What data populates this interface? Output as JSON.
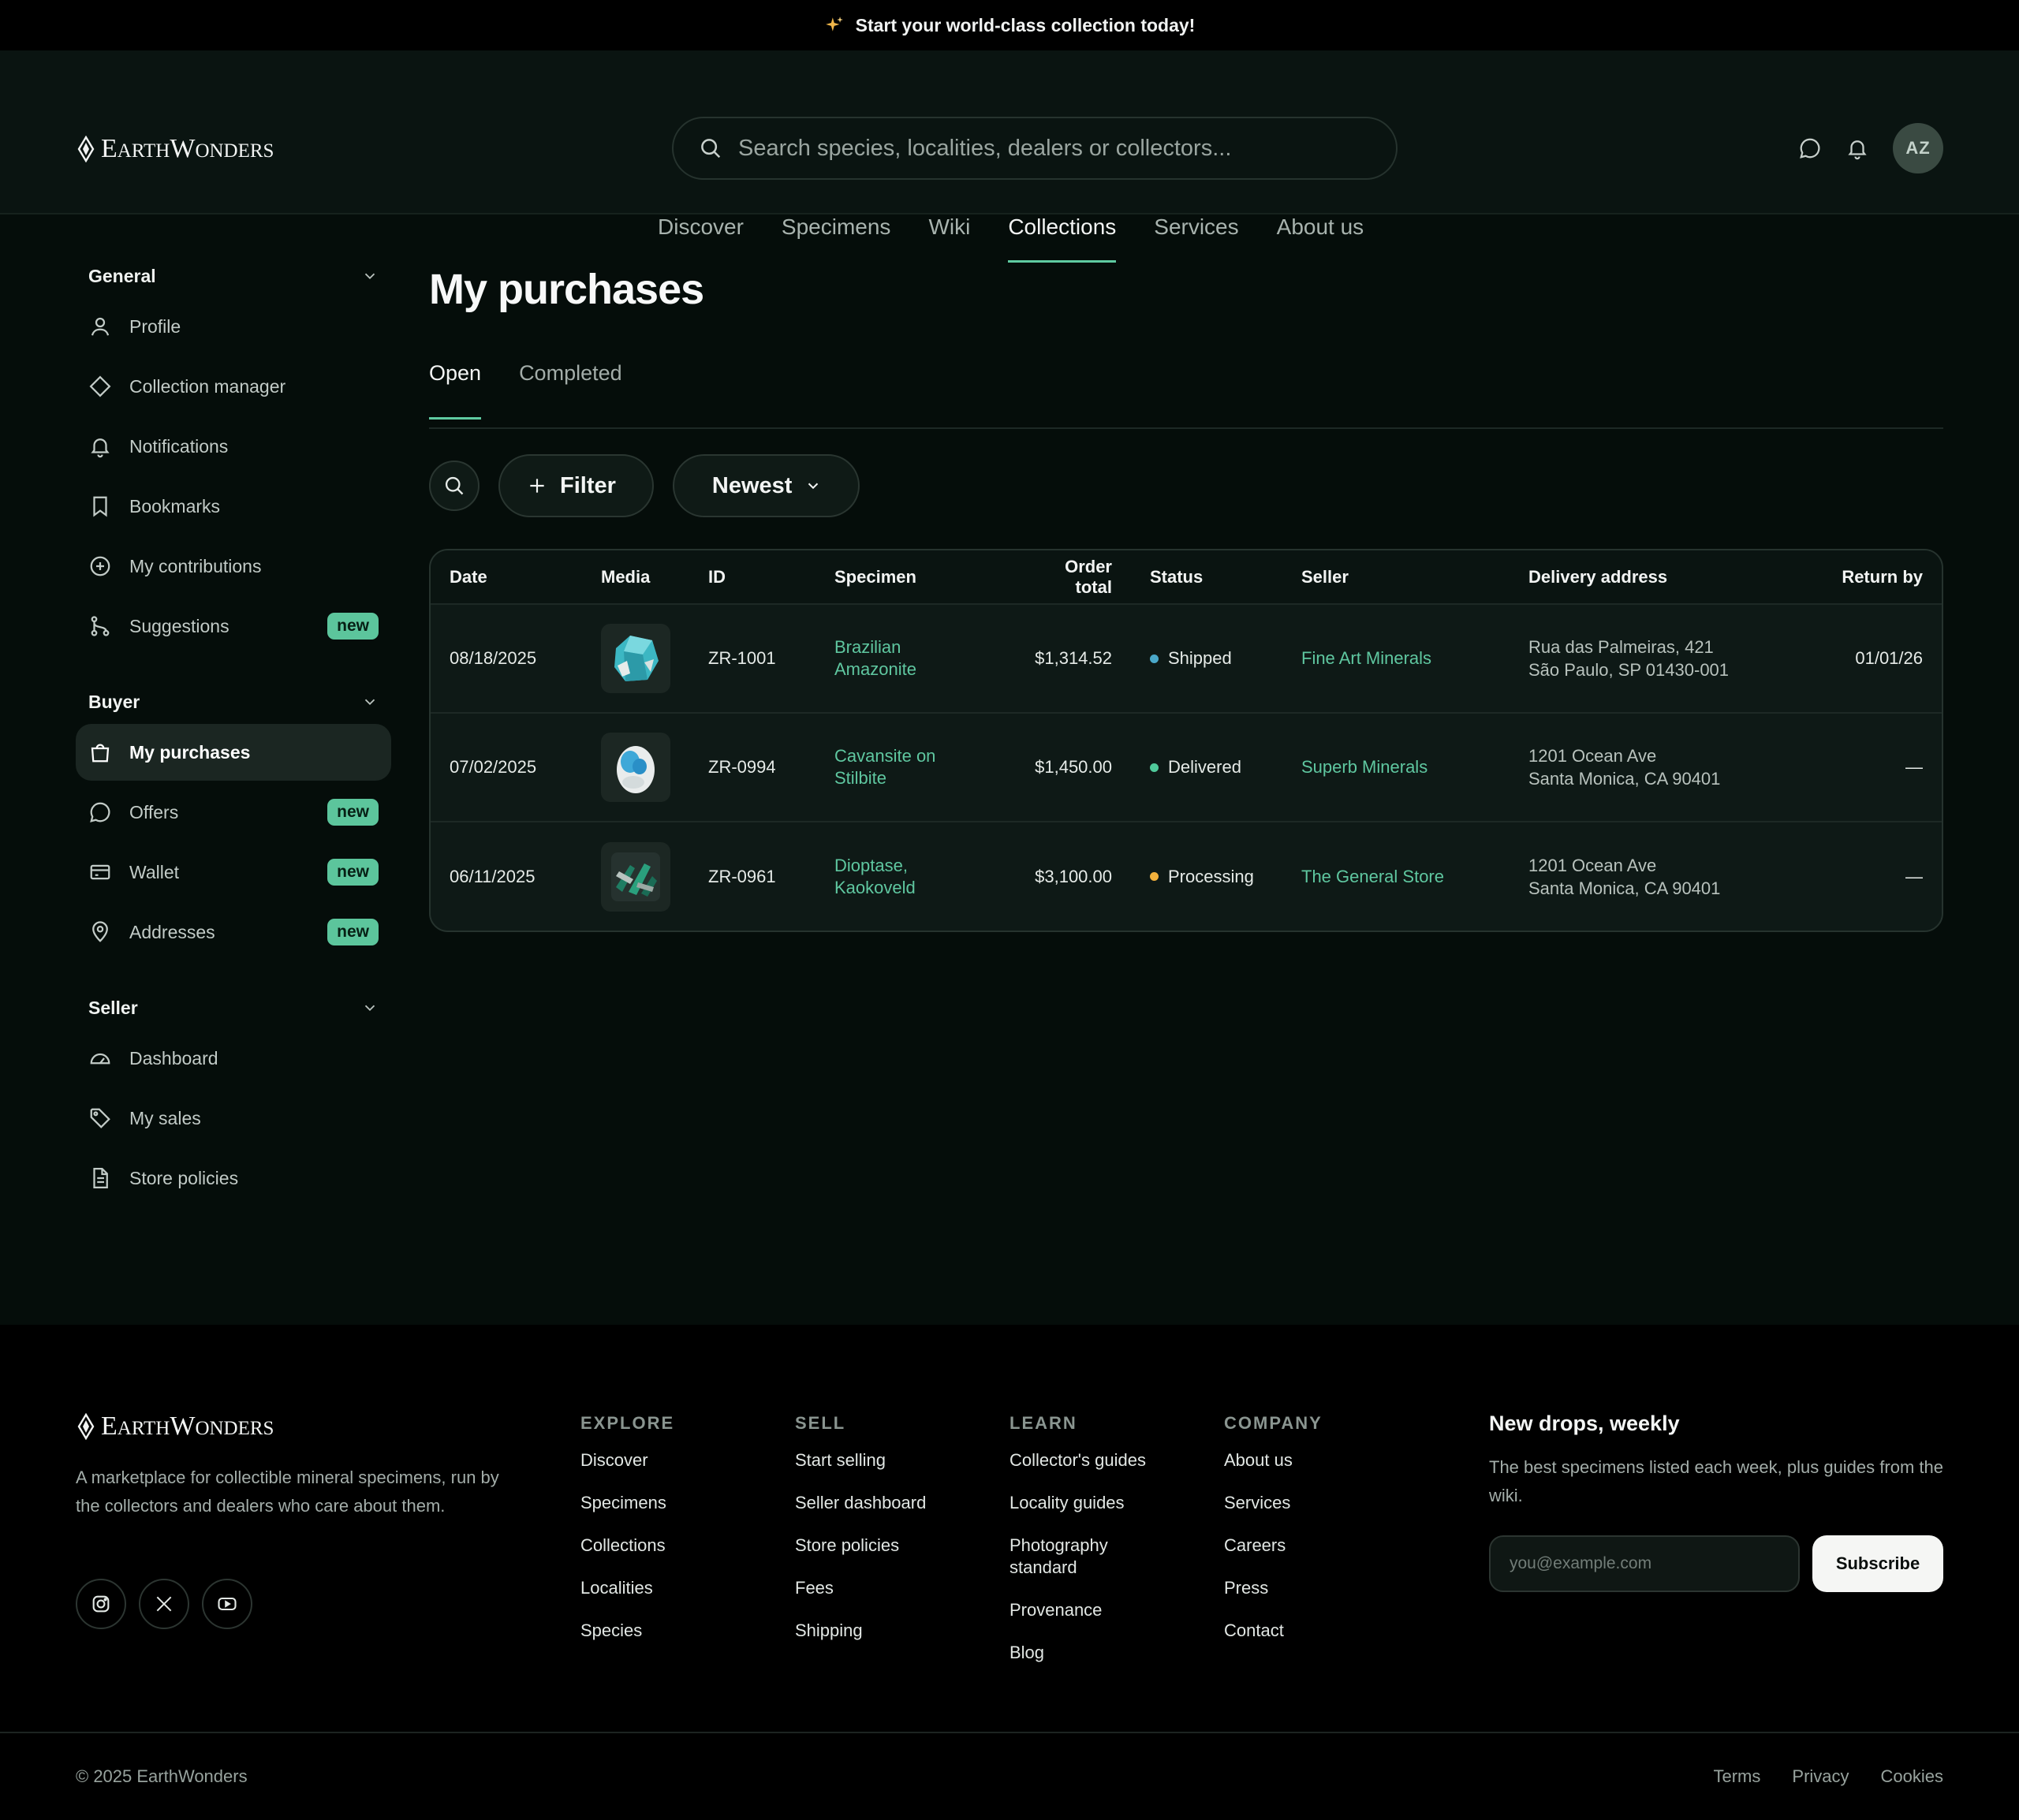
{
  "announcement": {
    "text": "Start your world-class collection today!"
  },
  "brand": {
    "name_first": "E",
    "name_rest": "ARTH",
    "name_second": "W",
    "name_rest2": "ONDERS"
  },
  "search": {
    "placeholder": "Search species, localities, dealers or collectors..."
  },
  "user": {
    "initials": "AZ"
  },
  "nav": {
    "items": [
      {
        "label": "Discover"
      },
      {
        "label": "Specimens"
      },
      {
        "label": "Wiki"
      },
      {
        "label": "Collections",
        "active": true
      },
      {
        "label": "Services"
      },
      {
        "label": "About us"
      }
    ]
  },
  "sidebar": {
    "general": {
      "title": "General",
      "items": [
        {
          "label": "Profile",
          "icon": "user-icon"
        },
        {
          "label": "Collection manager",
          "icon": "diamond-icon"
        },
        {
          "label": "Notifications",
          "icon": "bell-icon"
        },
        {
          "label": "Bookmarks",
          "icon": "bookmark-icon"
        },
        {
          "label": "My contributions",
          "icon": "plus-circle-icon"
        },
        {
          "label": "Suggestions",
          "icon": "git-branch-icon",
          "badge": "new"
        }
      ]
    },
    "buyer": {
      "title": "Buyer",
      "items": [
        {
          "label": "My purchases",
          "icon": "shopping-bag-icon",
          "active": true
        },
        {
          "label": "Offers",
          "icon": "chat-icon",
          "badge": "new"
        },
        {
          "label": "Wallet",
          "icon": "wallet-icon",
          "badge": "new"
        },
        {
          "label": "Addresses",
          "icon": "map-pin-icon",
          "badge": "new"
        }
      ]
    },
    "seller": {
      "title": "Seller",
      "items": [
        {
          "label": "Dashboard",
          "icon": "gauge-icon"
        },
        {
          "label": "My sales",
          "icon": "tag-icon"
        },
        {
          "label": "Store policies",
          "icon": "document-icon"
        }
      ]
    }
  },
  "main": {
    "title": "My purchases",
    "tabs": [
      {
        "label": "Open",
        "active": true
      },
      {
        "label": "Completed"
      }
    ],
    "filter_label": "Filter",
    "sort_label": "Newest"
  },
  "table": {
    "columns": [
      "Date",
      "Media",
      "ID",
      "Specimen",
      "Order total",
      "Status",
      "Seller",
      "Delivery address",
      "Return by"
    ],
    "rows": [
      {
        "date": "08/18/2025",
        "id": "ZR-1001",
        "specimen_line1": "Brazilian",
        "specimen_line2": "Amazonite",
        "total": "$1,314.52",
        "status": "Shipped",
        "status_color": "#4aa8c9",
        "seller": "Fine Art Minerals",
        "addr1": "Rua das Palmeiras, 421",
        "addr2": "São Paulo, SP 01430-001",
        "return_by": "01/01/26"
      },
      {
        "date": "07/02/2025",
        "id": "ZR-0994",
        "specimen_line1": "Cavansite on",
        "specimen_line2": "Stilbite",
        "total": "$1,450.00",
        "status": "Delivered",
        "status_color": "#4fc99a",
        "seller": "Superb Minerals",
        "addr1": "1201 Ocean Ave",
        "addr2": "Santa Monica, CA 90401",
        "return_by": "—"
      },
      {
        "date": "06/11/2025",
        "id": "ZR-0961",
        "specimen_line1": "Dioptase,",
        "specimen_line2": "Kaokoveld",
        "total": "$3,100.00",
        "status": "Processing",
        "status_color": "#f2b13c",
        "seller": "The General Store",
        "addr1": "1201 Ocean Ave",
        "addr2": "Santa Monica, CA 90401",
        "return_by": "—"
      }
    ]
  },
  "footer": {
    "description": "A marketplace for collectible mineral specimens, run by the collectors and dealers who care about them.",
    "columns": [
      {
        "title": "EXPLORE",
        "links": [
          "Discover",
          "Specimens",
          "Collections",
          "Localities",
          "Species"
        ]
      },
      {
        "title": "SELL",
        "links": [
          "Start selling",
          "Seller dashboard",
          "Store policies",
          "Fees",
          "Shipping"
        ]
      },
      {
        "title": "LEARN",
        "links": [
          "Collector's guides",
          "Locality guides",
          "Photography standard",
          "Provenance",
          "Blog"
        ]
      },
      {
        "title": "COMPANY",
        "links": [
          "About us",
          "Services",
          "Careers",
          "Press",
          "Contact"
        ]
      }
    ],
    "newsletter": {
      "title": "New drops, weekly",
      "text": "The best specimens listed each week, plus guides from the wiki.",
      "placeholder": "you@example.com",
      "button": "Subscribe"
    },
    "copyright": "© 2025 EarthWonders",
    "legal": [
      "Terms",
      "Privacy",
      "Cookies"
    ]
  }
}
